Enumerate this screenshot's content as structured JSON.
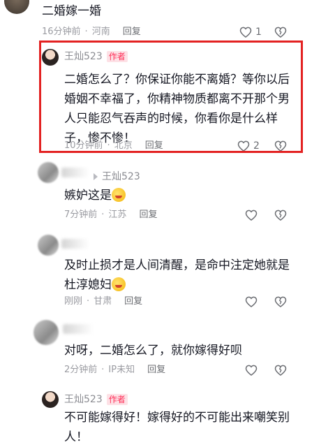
{
  "comments": [
    {
      "text": "二婚嫁一婚",
      "time": "16分钟前",
      "location": "河南",
      "reply": "回复",
      "likes": "1"
    },
    {
      "author": "王灿523",
      "badge": "作者",
      "text_lines": [
        "二婚怎么了？你保证你能不离婚？等你以后",
        "婚姻不幸福了，你精神物质都离不开那个男",
        "人只能忍气吞声的时候，你看你是什么样",
        "子，惨不惨！"
      ],
      "time": "10分钟前",
      "location": "北京",
      "reply": "回复",
      "likes": "2"
    },
    {
      "reply_to": "王灿523",
      "text": "嫉妒这是",
      "time": "7分钟前",
      "location": "江苏",
      "reply": "回复"
    },
    {
      "text_lines": [
        "及时止损才是人间清醒，是命中注定她就是",
        "杜淳媳妇"
      ],
      "time": "刚刚",
      "location": "甘肃",
      "reply": "回复"
    },
    {
      "text": "对呀，二婚怎么了，就你嫁得好呗",
      "time": "2分钟前",
      "location": "IP未知",
      "reply": "回复"
    },
    {
      "author": "王灿523",
      "badge": "作者",
      "text_lines": [
        "不可能嫁得好！嫁得好的不可能出来嘲笑别",
        "人！"
      ]
    }
  ],
  "colors": {
    "highlight": "#e32222",
    "badge_text": "#fe2c55",
    "meta": "#9a9ba1"
  },
  "icons": [
    "heart-icon",
    "dislike-heart-icon",
    "reply-arrow-icon",
    "laugh-emoji-icon",
    "blush-emoji-icon"
  ]
}
